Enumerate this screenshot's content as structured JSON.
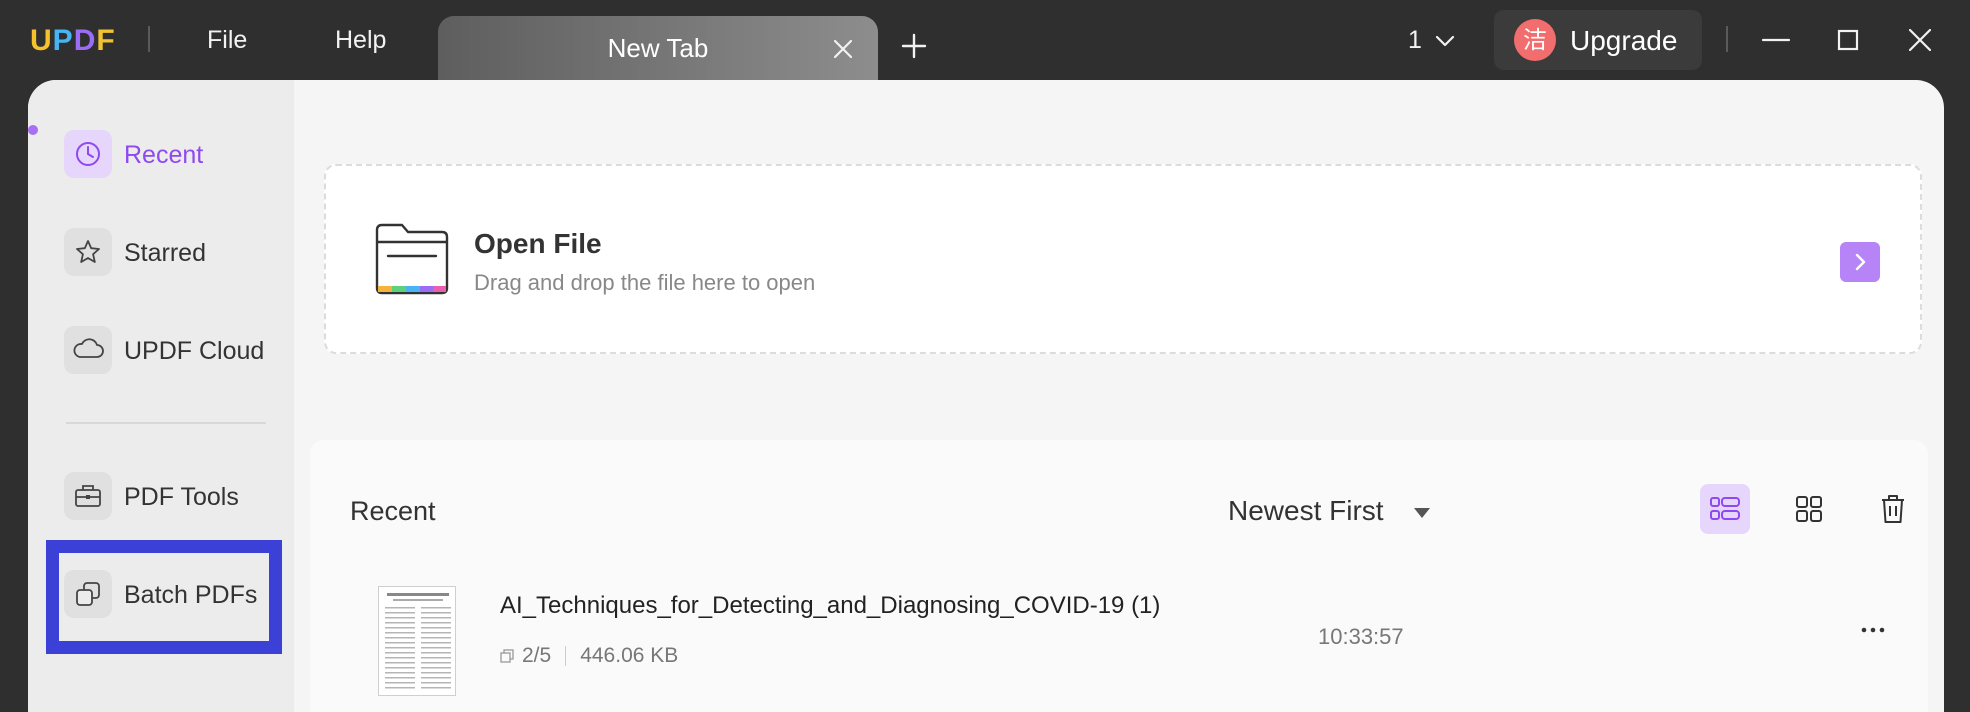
{
  "app": {
    "logo_letters": [
      "U",
      "P",
      "D",
      "F"
    ],
    "logo_colors": [
      "#f6c12a",
      "#47b5f3",
      "#9b6cf6",
      "#f2c230"
    ]
  },
  "menu": {
    "file": "File",
    "help": "Help"
  },
  "tab": {
    "title": "New Tab"
  },
  "window_count": "1",
  "upgrade": {
    "avatar_char": "洁",
    "label": "Upgrade",
    "avatar_color": "#f26e6e"
  },
  "sidebar": {
    "items": [
      {
        "label": "Recent",
        "icon": "clock-icon",
        "active": true
      },
      {
        "label": "Starred",
        "icon": "star-icon"
      },
      {
        "label": "UPDF Cloud",
        "icon": "cloud-icon"
      },
      {
        "label": "PDF Tools",
        "icon": "briefcase-icon"
      },
      {
        "label": "Batch PDFs",
        "icon": "batch-icon"
      }
    ],
    "accent": "#8e49f0"
  },
  "open_file": {
    "title": "Open File",
    "subtitle": "Drag and drop the file here to open"
  },
  "recent": {
    "title": "Recent",
    "sort": "Newest First",
    "files": [
      {
        "name": "AI_Techniques_for_Detecting_and_Diagnosing_COVID-19 (1)",
        "pages": "2/5",
        "size": "446.06 KB",
        "time": "10:33:57"
      }
    ]
  }
}
